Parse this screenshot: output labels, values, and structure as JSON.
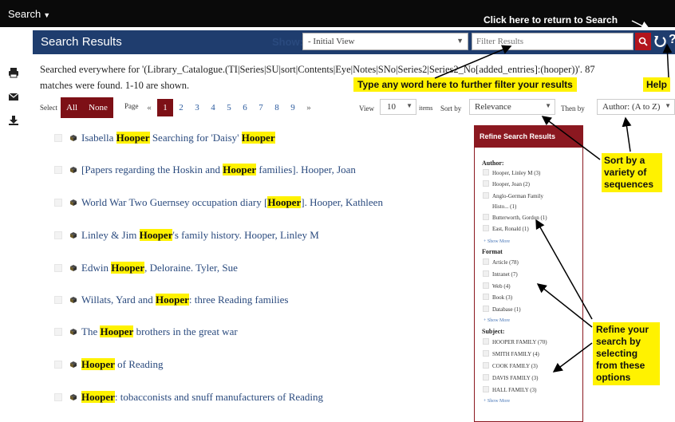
{
  "topbar": {
    "search_menu": "Search"
  },
  "header": {
    "title": "Search Results",
    "show_label": "Show:",
    "view_select": "- Initial View",
    "filter_placeholder": "Filter Results"
  },
  "summary": {
    "line1": "Searched everywhere for '(Library_Catalogue.(TI|Series|SU|sort|Contents|Eye|Notes|SNo|Series2|Series2_No[added_entries]:(hooper))'. 87",
    "line2": "matches were found. 1-10 are shown."
  },
  "toolbar": {
    "select_label": "Select",
    "all_button": "All",
    "none_button": "None",
    "page_label": "Page",
    "pager": [
      "«",
      "1",
      "2",
      "3",
      "4",
      "5",
      "6",
      "7",
      "8",
      "9",
      "»"
    ],
    "current_page": "1",
    "view_label": "View",
    "per_page": "10",
    "items_label": "items",
    "sortby_label": "Sort by",
    "sort_value": "Relevance",
    "thenby_label": "Then by",
    "thenby_value": "Author: (A to Z)"
  },
  "results": [
    {
      "pre": "Isabella ",
      "hl": "Hooper",
      "mid": " Searching for 'Daisy' ",
      "hl2": "Hooper",
      "post": ""
    },
    {
      "pre": "[Papers regarding the Hoskin and ",
      "hl": "Hooper",
      "mid": " families]. Hooper, Joan",
      "hl2": "",
      "post": ""
    },
    {
      "pre": "World War Two Guernsey occupation diary [",
      "hl": "Hooper",
      "mid": "]. Hooper, Kathleen",
      "hl2": "",
      "post": ""
    },
    {
      "pre": "Linley & Jim ",
      "hl": "Hooper",
      "mid": "'s family history. Hooper, Linley M",
      "hl2": "",
      "post": ""
    },
    {
      "pre": "Edwin ",
      "hl": "Hooper",
      "mid": ", Deloraine. Tyler, Sue",
      "hl2": "",
      "post": ""
    },
    {
      "pre": "Willats, Yard and ",
      "hl": "Hooper",
      "mid": ": three Reading families",
      "hl2": "",
      "post": ""
    },
    {
      "pre": "The ",
      "hl": "Hooper",
      "mid": " brothers in the great war",
      "hl2": "",
      "post": ""
    },
    {
      "pre": "",
      "hl": "Hooper",
      "mid": " of Reading",
      "hl2": "",
      "post": ""
    },
    {
      "pre": "",
      "hl": "Hooper",
      "mid": ": tobacconists and snuff manufacturers of Reading",
      "hl2": "",
      "post": ""
    }
  ],
  "refine": {
    "title": "Refine Search Results",
    "author_label": "Author:",
    "author_options": [
      "Hooper, Linley M (3)",
      "Hooper, Joan (2)",
      "Anglo-German Family",
      "Histo... (1)",
      "Butterworth, Gordon (1)",
      "East, Ronald (1)"
    ],
    "show_more": "+ Show More",
    "format_label": "Format",
    "format_options": [
      "Article (78)",
      "Intranet (7)",
      "Web (4)",
      "Book (3)",
      "Database (1)"
    ],
    "subject_label": "Subject:",
    "subject_options": [
      "HOOPER FAMILY (70)",
      "SMITH FAMILY (4)",
      "COOK FAMILY (3)",
      "DAVIS FAMILY (3)",
      "HALL FAMILY (3)"
    ]
  },
  "annotations": {
    "return": "Click here to return to Search",
    "filter": "Type any word here to further filter your results",
    "help": "Help",
    "sort": "Sort by a variety of sequences",
    "refine": "Refine your search by selecting from these options"
  },
  "colors": {
    "header_bg": "#1f3d6e",
    "topbar_bg": "#0a0a0a",
    "accent_red": "#8b1820",
    "highlight": "#fff200",
    "link": "#2a4a7e"
  },
  "icons": {
    "menu_caret": "caret-down-icon",
    "filter_search": "search-icon",
    "refresh": "refresh-icon",
    "help": "question-icon",
    "print": "print-icon",
    "email": "email-icon",
    "download": "download-icon",
    "book": "book-icon"
  }
}
